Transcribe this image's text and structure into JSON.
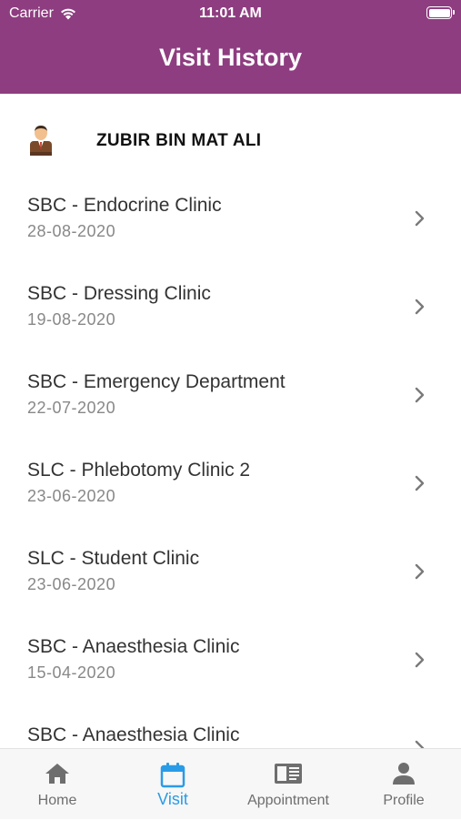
{
  "status_bar": {
    "carrier": "Carrier",
    "time": "11:01 AM",
    "battery_level": 1.0
  },
  "header": {
    "title": "Visit History",
    "background": "#8e3d80"
  },
  "patient": {
    "name": "ZUBIR BIN MAT ALI",
    "avatar_icon": "person-avatar-icon"
  },
  "visits": [
    {
      "clinic": "SBC - Endocrine Clinic",
      "date": "28-08-2020"
    },
    {
      "clinic": "SBC - Dressing Clinic",
      "date": "19-08-2020"
    },
    {
      "clinic": "SBC - Emergency Department",
      "date": "22-07-2020"
    },
    {
      "clinic": "SLC - Phlebotomy Clinic 2",
      "date": "23-06-2020"
    },
    {
      "clinic": "SLC - Student Clinic",
      "date": "23-06-2020"
    },
    {
      "clinic": "SBC - Anaesthesia Clinic",
      "date": "15-04-2020"
    },
    {
      "clinic": "SBC - Anaesthesia Clinic",
      "date": ""
    }
  ],
  "tabs": [
    {
      "label": "Home",
      "icon": "home-icon",
      "active": false
    },
    {
      "label": "Visit",
      "icon": "calendar-icon",
      "active": true
    },
    {
      "label": "Appointment",
      "icon": "book-icon",
      "active": false
    },
    {
      "label": "Profile",
      "icon": "person-icon",
      "active": false
    }
  ],
  "colors": {
    "accent": "#2a9be6",
    "inactive": "#6e6e6e",
    "brand": "#8e3d80"
  }
}
